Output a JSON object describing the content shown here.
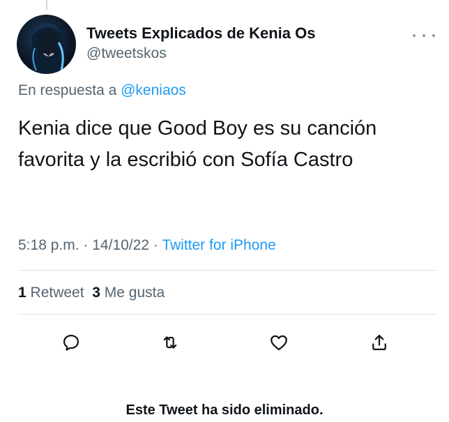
{
  "author": {
    "name": "Tweets Explicados de Kenia Os",
    "handle": "@tweetskos"
  },
  "reply_to": {
    "prefix": "En respuesta a",
    "mention": "@keniaos"
  },
  "tweet": {
    "text": "Kenia dice que Good Boy es su canción favorita y la escribió con Sofía Castro"
  },
  "meta": {
    "time": "5:18 p.m.",
    "separator": "·",
    "date": "14/10/22",
    "source": "Twitter for iPhone"
  },
  "stats": {
    "retweets_count": "1",
    "retweets_label": "Retweet",
    "likes_count": "3",
    "likes_label": "Me gusta"
  },
  "actions": {
    "reply_icon": "reply-icon",
    "retweet_icon": "retweet-icon",
    "like_icon": "heart-icon",
    "share_icon": "share-icon"
  },
  "footer": {
    "message": "Este Tweet ha sido eliminado."
  },
  "colors": {
    "link": "#1d9bf0",
    "secondary_text": "#536471",
    "primary_text": "#0f1419",
    "divider": "#dde3e8"
  }
}
